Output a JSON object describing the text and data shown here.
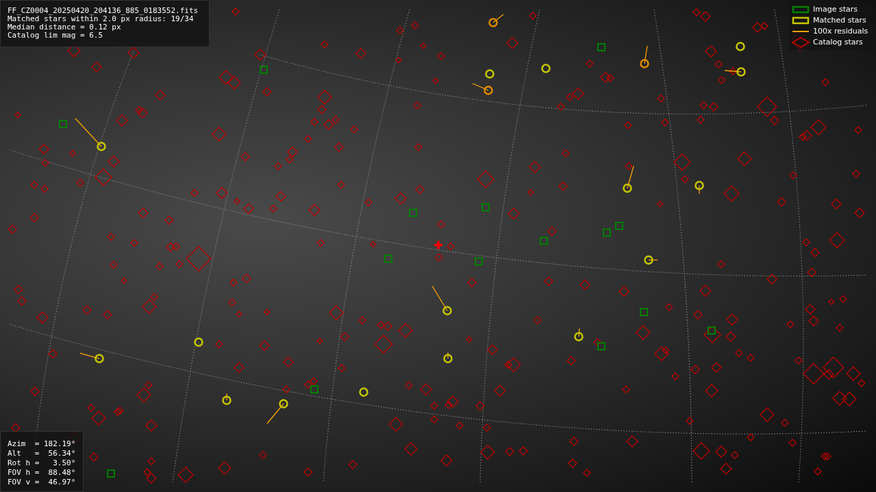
{
  "info_box": {
    "lines": [
      "FF_CZ0004_20250420_204136_885_0183552.fits",
      "Matched stars within 2.0 px radius: 19/34",
      "Median distance = 0.12 px",
      "Catalog lim mag = 6.5"
    ]
  },
  "legend": [
    {
      "kind": "square",
      "label": "Image stars",
      "color": "#008000"
    },
    {
      "kind": "square",
      "label": "Matched stars",
      "color": "#c8c800"
    },
    {
      "kind": "line",
      "label": "100x residuals",
      "color": "#ffa500"
    },
    {
      "kind": "diamond",
      "label": "Catalog stars",
      "color": "#c00000"
    }
  ],
  "pointing_box": {
    "lines": [
      "Azim  = 182.19°",
      "Alt   =  56.34°",
      "Rot h =   3.50°",
      "FOV h =  88.48°",
      "FOV v =  46.97°"
    ]
  }
}
